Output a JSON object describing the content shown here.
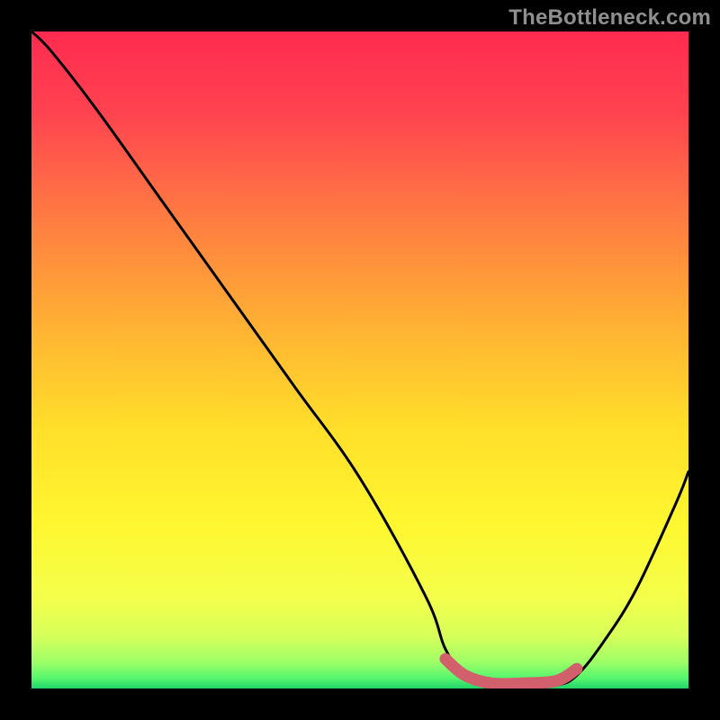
{
  "watermark": "TheBottleneck.com",
  "chart_data": {
    "type": "line",
    "title": "",
    "xlabel": "",
    "ylabel": "",
    "xlim": [
      0,
      100
    ],
    "ylim": [
      0,
      100
    ],
    "grid": false,
    "legend": false,
    "series": [
      {
        "name": "bottleneck-curve",
        "x": [
          0,
          3,
          10,
          20,
          30,
          40,
          50,
          60,
          63,
          66,
          70,
          75,
          80,
          83,
          87,
          92,
          98,
          100
        ],
        "y": [
          100,
          97,
          88,
          74,
          60,
          46,
          32,
          14,
          6,
          2,
          0,
          0,
          0.5,
          2,
          7,
          15,
          28,
          33
        ]
      },
      {
        "name": "optimal-zone",
        "x": [
          63,
          66,
          70,
          75,
          80,
          83
        ],
        "y": [
          4.5,
          2.0,
          0.8,
          0.8,
          1.2,
          3.0
        ]
      }
    ],
    "gradient_stops": [
      {
        "offset": 0.0,
        "color": "#ff2b4f"
      },
      {
        "offset": 0.12,
        "color": "#ff4250"
      },
      {
        "offset": 0.28,
        "color": "#ff7a42"
      },
      {
        "offset": 0.45,
        "color": "#ffb233"
      },
      {
        "offset": 0.6,
        "color": "#ffde2a"
      },
      {
        "offset": 0.75,
        "color": "#fff730"
      },
      {
        "offset": 0.86,
        "color": "#f4ff4a"
      },
      {
        "offset": 0.92,
        "color": "#d7ff5a"
      },
      {
        "offset": 0.96,
        "color": "#9dff67"
      },
      {
        "offset": 0.985,
        "color": "#54f56e"
      },
      {
        "offset": 1.0,
        "color": "#22d36a"
      }
    ],
    "colors": {
      "curve": "#000000",
      "optimal_marker": "#d1606c"
    }
  }
}
